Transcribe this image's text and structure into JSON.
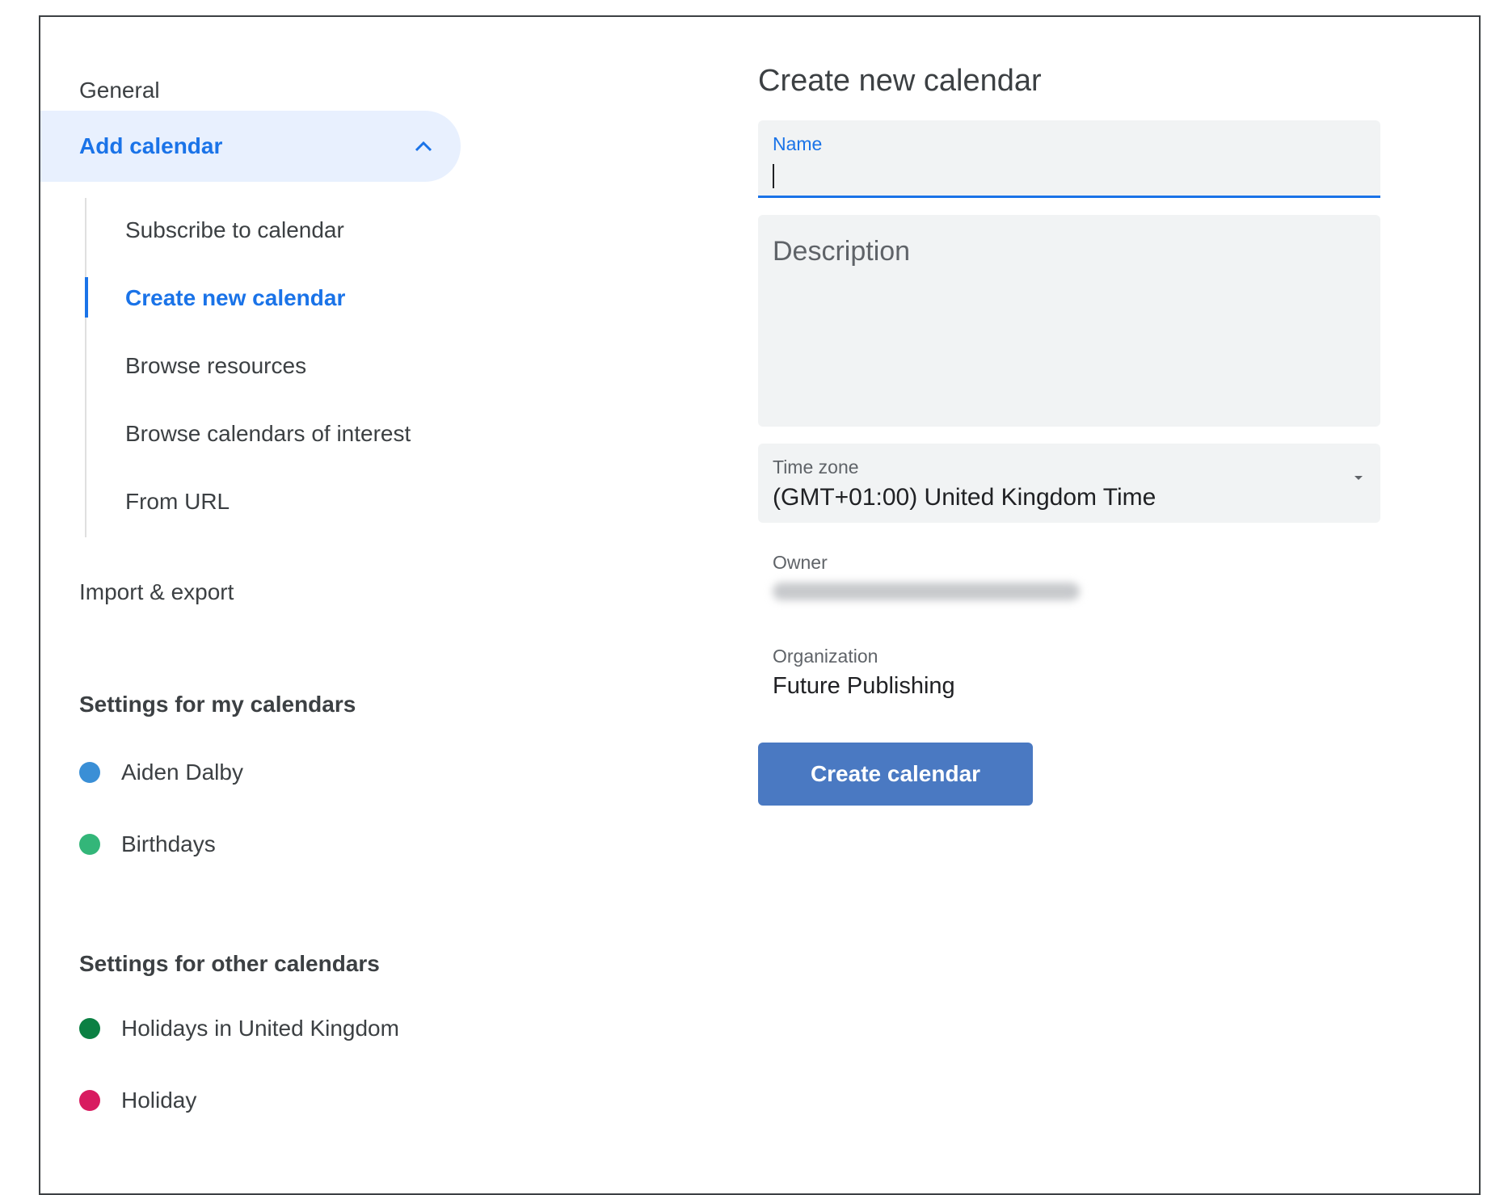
{
  "sidebar": {
    "general": "General",
    "add_calendar": "Add calendar",
    "add_calendar_items": [
      "Subscribe to calendar",
      "Create new calendar",
      "Browse resources",
      "Browse calendars of interest",
      "From URL"
    ],
    "import_export": "Import & export",
    "my_calendars_heading": "Settings for my calendars",
    "my_calendars": [
      {
        "name": "Aiden Dalby",
        "color": "#3a8fd6"
      },
      {
        "name": "Birthdays",
        "color": "#33b679"
      }
    ],
    "other_calendars_heading": "Settings for other calendars",
    "other_calendars": [
      {
        "name": "Holidays in United Kingdom",
        "color": "#0b8043"
      },
      {
        "name": "Holiday",
        "color": "#d81b60"
      }
    ]
  },
  "form": {
    "title": "Create new calendar",
    "name_label": "Name",
    "name_value": "",
    "description_placeholder": "Description",
    "timezone_label": "Time zone",
    "timezone_value": "(GMT+01:00) United Kingdom Time",
    "owner_label": "Owner",
    "organization_label": "Organization",
    "organization_value": "Future Publishing",
    "create_button": "Create calendar"
  },
  "colors": {
    "accent": "#1a73e8",
    "button": "#4a79c2",
    "nav_active_bg": "#e8f0fe",
    "field_bg": "#f1f3f4"
  },
  "icons": {
    "add_calendar_toggle": "chevron-up-icon",
    "timezone_dropdown": "caret-down-icon"
  }
}
